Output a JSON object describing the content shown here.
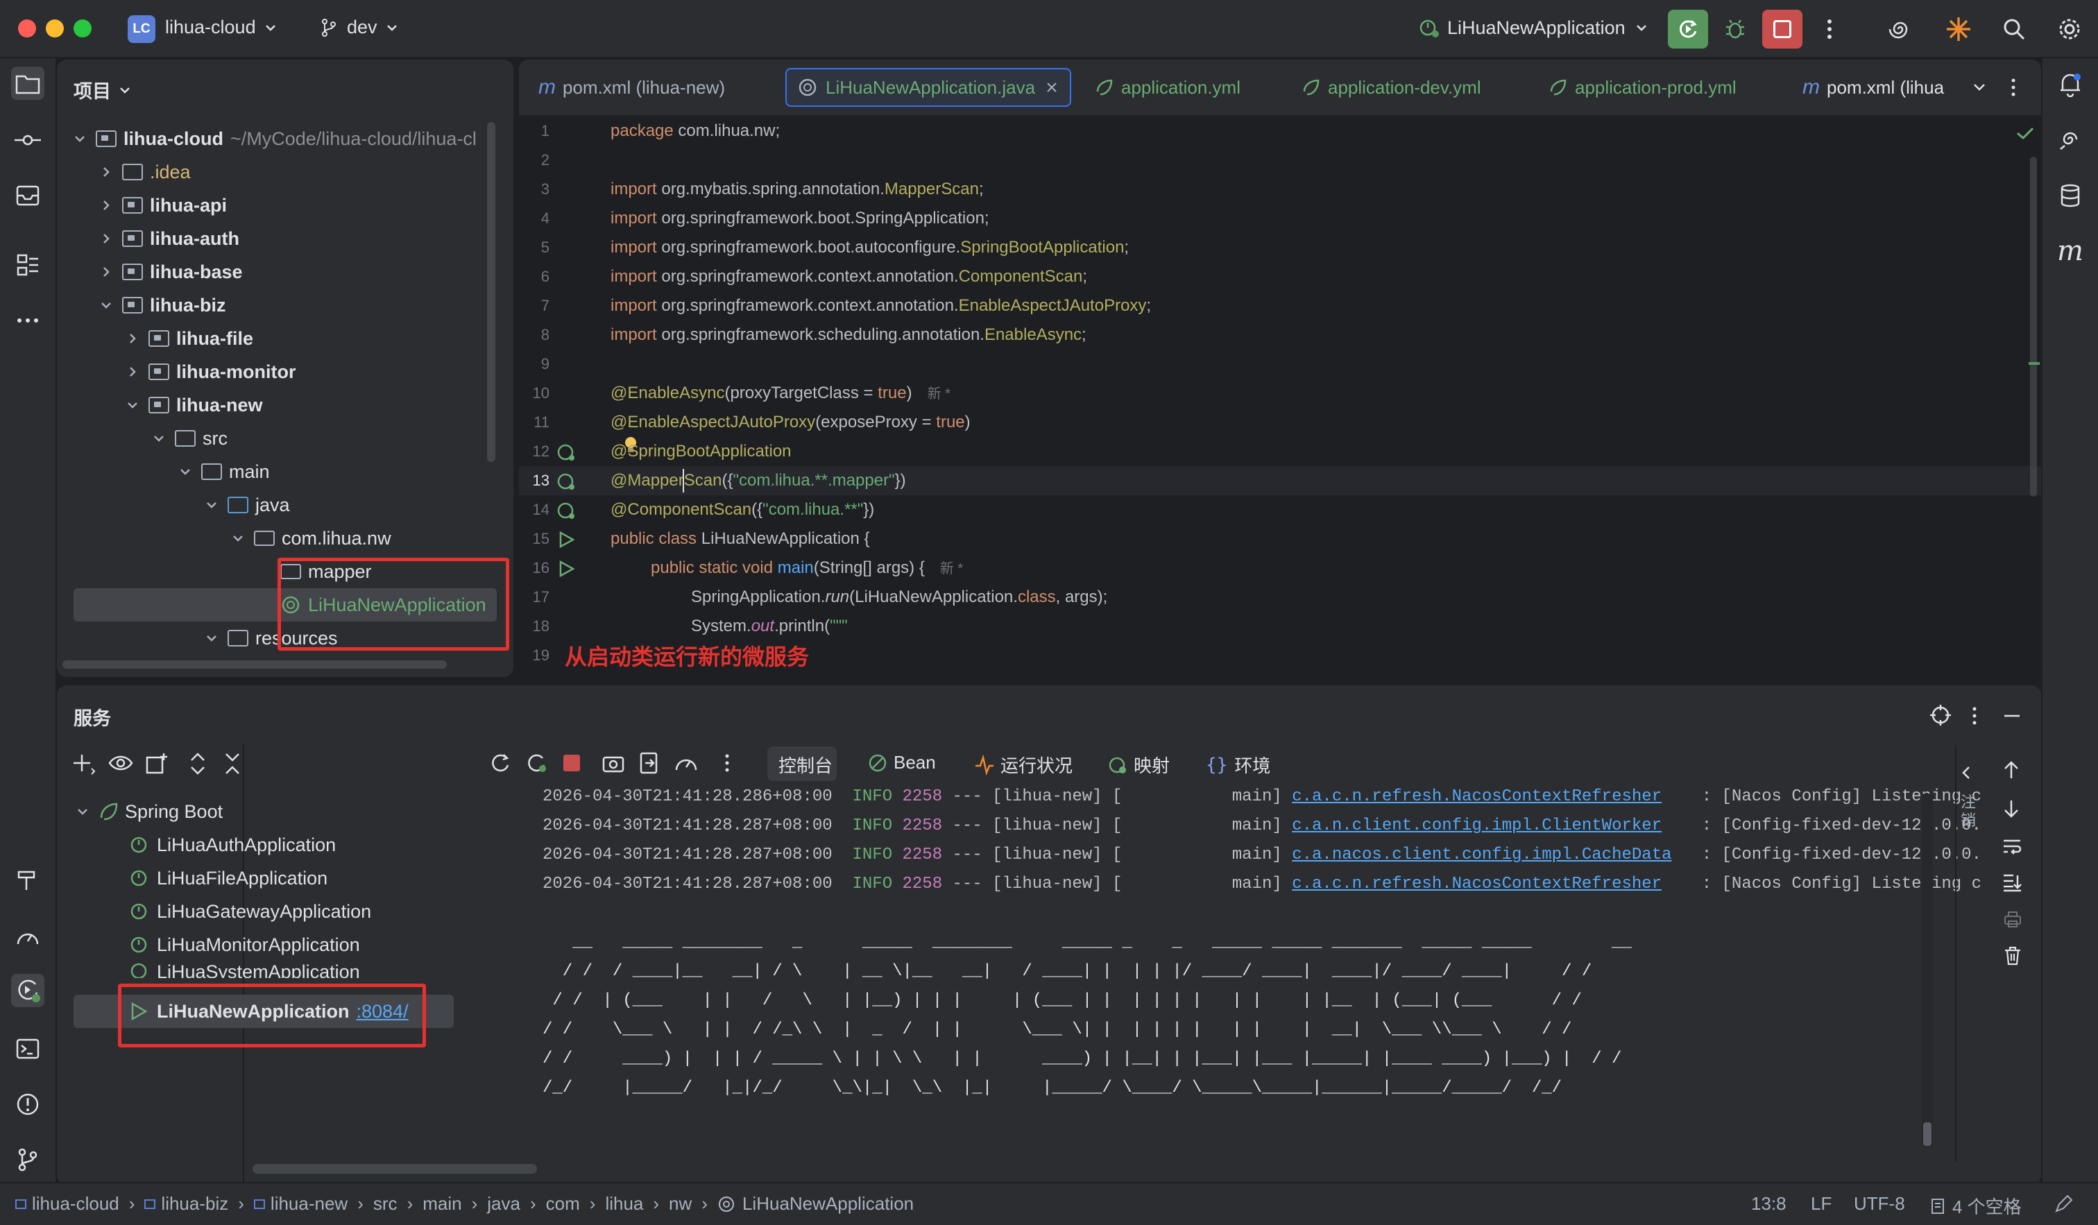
{
  "titlebar": {
    "project_badge": "LC",
    "project_name": "lihua-cloud",
    "branch": "dev",
    "run_config": "LiHuaNewApplication"
  },
  "project_panel": {
    "title": "项目",
    "root_name": "lihua-cloud",
    "root_path": "~/MyCode/lihua-cloud/lihua-cl",
    "items": [
      {
        "label": ".idea"
      },
      {
        "label": "lihua-api"
      },
      {
        "label": "lihua-auth"
      },
      {
        "label": "lihua-base"
      },
      {
        "label": "lihua-biz"
      },
      {
        "label": "lihua-file"
      },
      {
        "label": "lihua-monitor"
      },
      {
        "label": "lihua-new"
      },
      {
        "label": "src"
      },
      {
        "label": "main"
      },
      {
        "label": "java"
      },
      {
        "label": "com.lihua.nw"
      },
      {
        "label": "mapper"
      },
      {
        "label": "LiHuaNewApplication"
      },
      {
        "label": "resources"
      }
    ]
  },
  "editor": {
    "tabs": [
      {
        "label": "pom.xml (lihua-new)"
      },
      {
        "label": "LiHuaNewApplication.java"
      },
      {
        "label": "application.yml"
      },
      {
        "label": "application-dev.yml"
      },
      {
        "label": "application-prod.yml"
      },
      {
        "label": "pom.xml (lihua"
      }
    ],
    "line_numbers": [
      "1",
      "2",
      "3",
      "4",
      "5",
      "6",
      "7",
      "8",
      "9",
      "10",
      "11",
      "12",
      "13",
      "14",
      "15",
      "16",
      "17",
      "18",
      "19"
    ],
    "code": {
      "l1_kw": "package",
      "l1_rest": " com.lihua.nw;",
      "imp": "import",
      "l3_pkg": " org.mybatis.spring.annotation.",
      "l3_cls": "MapperScan",
      "l4_pkg": " org.springframework.boot.SpringApplication;",
      "l5_pkg": " org.springframework.boot.autoconfigure.",
      "l5_cls": "SpringBootApplication",
      "l6_pkg": " org.springframework.context.annotation.",
      "l6_cls": "ComponentScan",
      "l7_pkg": " org.springframework.context.annotation.",
      "l7_cls": "EnableAspectJAutoProxy",
      "l8_pkg": " org.springframework.scheduling.annotation.",
      "l8_cls": "EnableAsync",
      "semi": ";",
      "l10_ann": "@EnableAsync",
      "l10_open": "(proxyTargetClass = ",
      "l10_true": "true",
      "l10_close": ")",
      "new_hint": "新 *",
      "l11_ann": "@EnableAspectJAutoProxy",
      "l11_open": "(exposeProxy = ",
      "l11_true": "true",
      "l11_close": ")",
      "l12_ann": "@SpringBootApplication",
      "l13_ann": "@MapperScan",
      "l13_open": "({",
      "l13_str": "\"com.lihua.**.mapper\"",
      "l13_close": "})",
      "l14_ann": "@ComponentScan",
      "l14_open": "({",
      "l14_str": "\"com.lihua.**\"",
      "l14_close": "})",
      "l15_kw": "public class",
      "l15_rest": " LiHuaNewApplication {",
      "l16_kw": "public static void",
      "l16_fn": " main",
      "l16_rest": "(String[] args) {",
      "l17_a": "SpringApplication.",
      "l17_fn": "run",
      "l17_b": "(LiHuaNewApplication.",
      "l17_kw": "class",
      "l17_c": ", args);",
      "l18_a": "System.",
      "l18_out": "out",
      "l18_b": ".println(",
      "l18_str": "\"\"\""
    },
    "annotation_note": "从启动类运行新的微服务"
  },
  "services": {
    "title": "服务",
    "group": "Spring Boot",
    "apps": [
      {
        "label": "LiHuaAuthApplication"
      },
      {
        "label": "LiHuaFileApplication"
      },
      {
        "label": "LiHuaGatewayApplication"
      },
      {
        "label": "LiHuaMonitorApplication"
      },
      {
        "label": "LiHuaSystemApplication"
      },
      {
        "label": "LiHuaNewApplication",
        "port": ":8084/"
      }
    ],
    "tabs": [
      {
        "label": "控制台"
      },
      {
        "label": "Bean"
      },
      {
        "label": "运行状况"
      },
      {
        "label": "映射"
      },
      {
        "label": "环境"
      }
    ],
    "side_label": "注销",
    "logs": [
      {
        "ts": "2026-04-30T21:41:28.286+08:00",
        "level": "INFO",
        "pid": "2258",
        "mid": " --- [lihua-new] [           main] ",
        "cls": "c.a.c.n.refresh.NacosContextRefresher",
        "msg": "    : [Nacos Config] Listening c"
      },
      {
        "ts": "2026-04-30T21:41:28.287+08:00",
        "level": "INFO",
        "pid": "2258",
        "mid": " --- [lihua-new] [           main] ",
        "cls": "c.a.n.client.config.impl.ClientWorker",
        "msg": "    : [Config-fixed-dev-127.0.0."
      },
      {
        "ts": "2026-04-30T21:41:28.287+08:00",
        "level": "INFO",
        "pid": "2258",
        "mid": " --- [lihua-new] [           main] ",
        "cls": "c.a.nacos.client.config.impl.CacheData",
        "msg": "   : [Config-fixed-dev-127.0.0."
      },
      {
        "ts": "2026-04-30T21:41:28.287+08:00",
        "level": "INFO",
        "pid": "2258",
        "mid": " --- [lihua-new] [           main] ",
        "cls": "c.a.c.n.refresh.NacosContextRefresher",
        "msg": "    : [Nacos Config] Listening c"
      }
    ],
    "banner": "   __   _____ ________   _      _____  ________     _____ _    _   _____ _____ _______  _____ _____        __\n  / /  / ____|__   __| / \\    | __ \\|__   __|   / ____| |  | | |/ ____/ ____|  ____|/ ____/ ____|     / /\n / /  | (___    | |   /   \\   | |__) | | |     | (___ | |  | | | |   | |    | |__  | (___| (___      / /\n/ /    \\___ \\   | |  / /_\\ \\  |  _  /  | |      \\___ \\| |  | | | |   | |    |  __|  \\___ \\\\___ \\    / /\n/ /     ____) |  | | / _____ \\ | | \\ \\   | |      ____) | |__| | |___| |___ |_____| |____ ____) |___) |  / /\n/_/     |_____/   |_|/_/     \\_\\|_|  \\_\\  |_|     |_____/ \\____/ \\_____\\_____|______|_____/_____/  /_/"
  },
  "statusbar": {
    "crumbs": [
      "lihua-cloud",
      "lihua-biz",
      "lihua-new",
      "src",
      "main",
      "java",
      "com",
      "lihua",
      "nw",
      "LiHuaNewApplication"
    ],
    "position": "13:8",
    "line_sep": "LF",
    "encoding": "UTF-8",
    "indent": "4 个空格"
  },
  "colors": {
    "accent": "#3574f0",
    "run_green": "#57965c",
    "stop_red": "#c94f4f",
    "highlight": "#e5322f"
  }
}
